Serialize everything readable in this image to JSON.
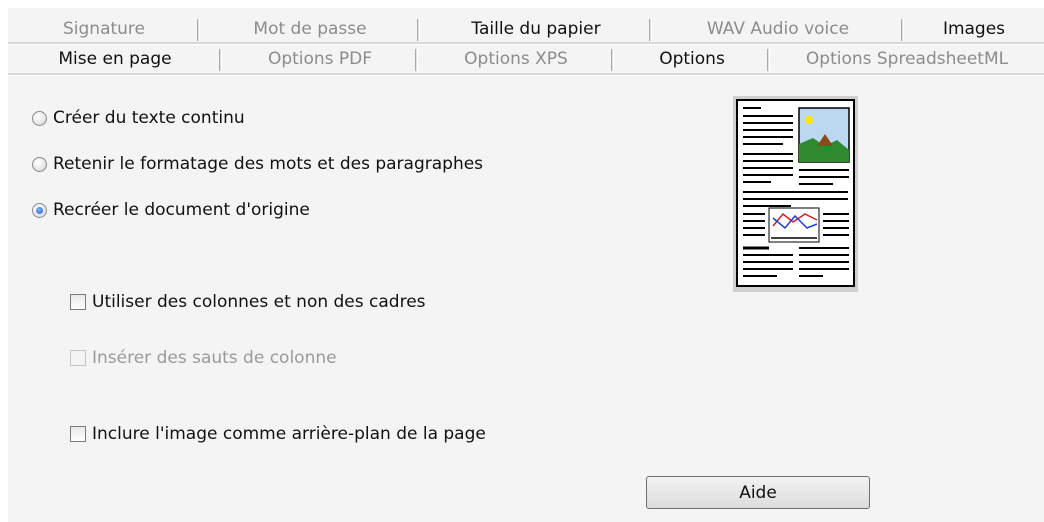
{
  "tabs_row1": [
    {
      "label": "Signature",
      "active": false
    },
    {
      "label": "Mot de passe",
      "active": false
    },
    {
      "label": "Taille du papier",
      "active": true
    },
    {
      "label": "WAV Audio voice",
      "active": false
    },
    {
      "label": "Images",
      "active": true
    }
  ],
  "tabs_row2": [
    {
      "label": "Mise en page",
      "active": true
    },
    {
      "label": "Options PDF",
      "active": false
    },
    {
      "label": "Options XPS",
      "active": false
    },
    {
      "label": "Options",
      "active": true
    },
    {
      "label": "Options SpreadsheetML",
      "active": false
    }
  ],
  "radios": [
    {
      "label": "Créer du texte continu",
      "checked": false
    },
    {
      "label": "Retenir le formatage des mots et des paragraphes",
      "checked": false
    },
    {
      "label": "Recréer le document d'origine",
      "checked": true
    }
  ],
  "checkboxes": [
    {
      "label": "Utiliser des colonnes et non des cadres",
      "checked": false,
      "enabled": true
    },
    {
      "label": "Insérer des sauts de colonne",
      "checked": false,
      "enabled": false
    },
    {
      "label": "Inclure l'image comme arrière-plan de la page",
      "checked": false,
      "enabled": true
    }
  ],
  "help_button": {
    "label": "Aide"
  },
  "preview_icon": "document-layout-preview-icon"
}
